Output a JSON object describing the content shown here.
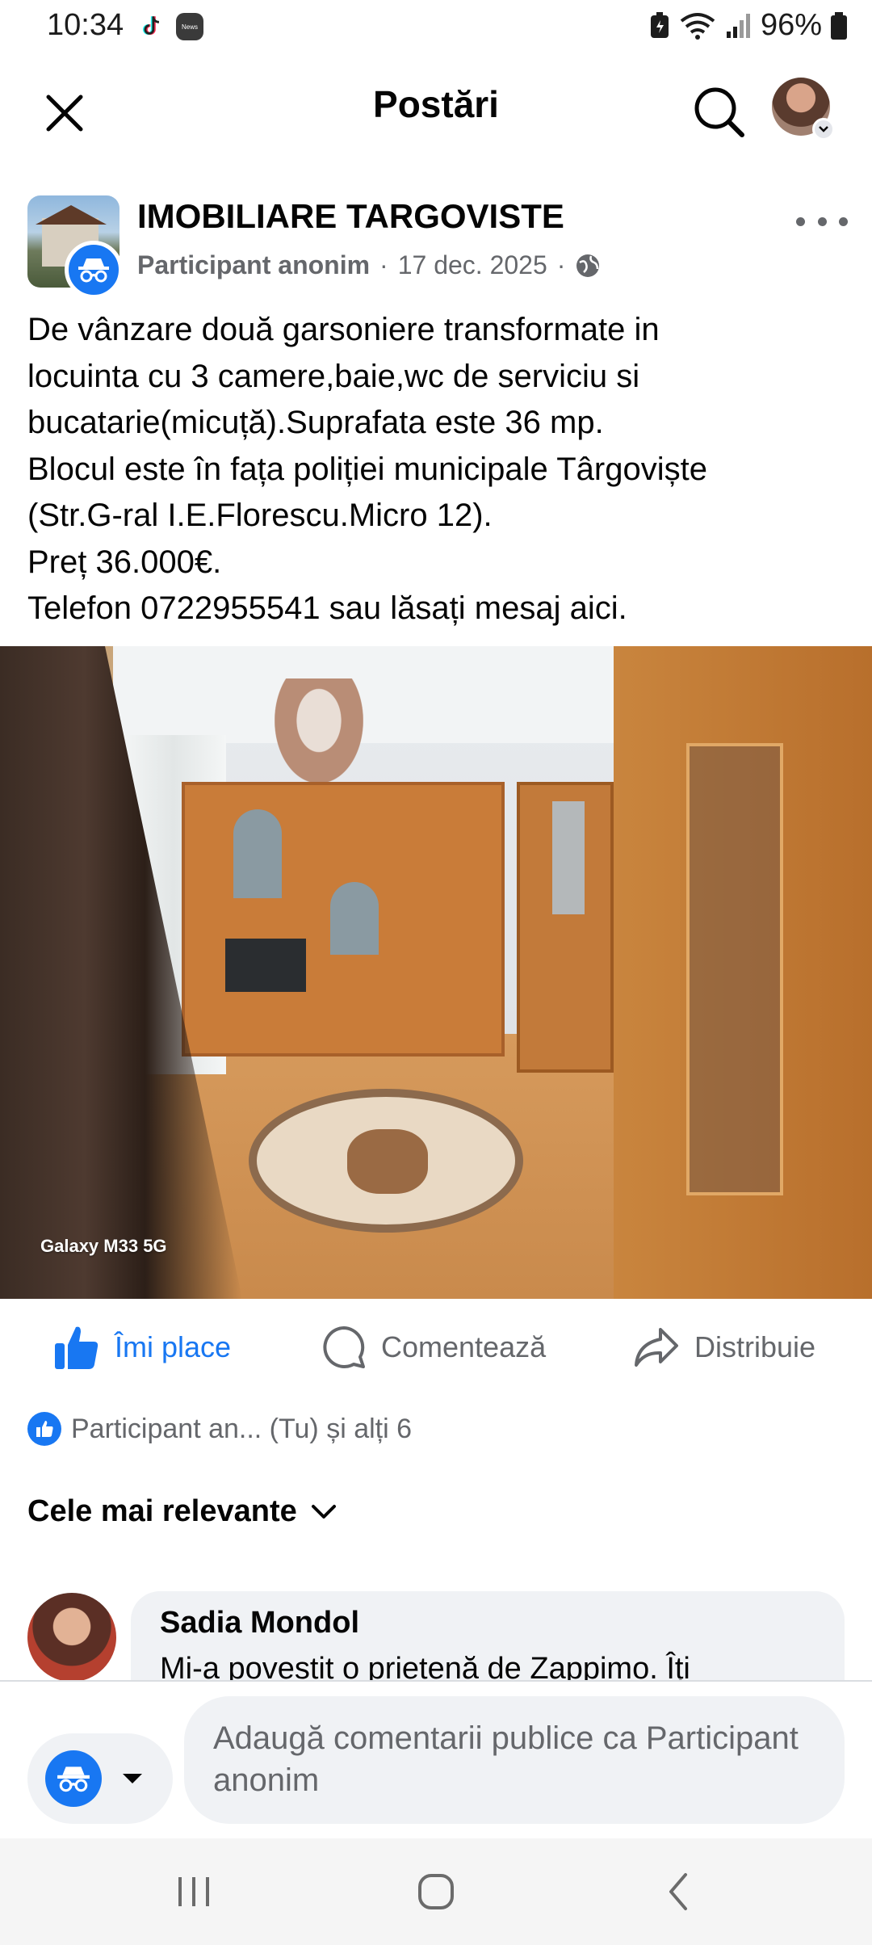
{
  "status_bar": {
    "time": "10:34",
    "news_label": "News",
    "battery": "96%",
    "icons": [
      "tiktok-icon",
      "news-icon",
      "battery-saver-icon",
      "wifi-icon",
      "signal-icon",
      "battery-icon"
    ]
  },
  "header": {
    "title": "Postări",
    "close_icon": "close-icon",
    "search_icon": "search-icon"
  },
  "post": {
    "group_name": "IMOBILIARE TARGOVISTE",
    "author": "Participant anonim",
    "separator": "·",
    "date": "17 dec. 2025",
    "visibility_icon": "globe-icon",
    "text_lines": [
      "De vânzare două garsoniere  transformate in",
      "locuinta cu 3 camere,baie,wc de serviciu si",
      "bucatarie(micuță).Suprafata este 36 mp.",
      "Blocul este în fața poliției municipale Târgoviște",
      "(Str.G-ral I.E.Florescu.Micro 12).",
      "Preț 36.000€.",
      "Telefon 0722955541 sau lăsați mesaj aici."
    ],
    "photo_watermark": "Galaxy M33 5G"
  },
  "actions": {
    "like": "Îmi place",
    "comment": "Comentează",
    "share": "Distribuie"
  },
  "reactions": {
    "summary": "Participant an... (Tu) și alți 6"
  },
  "sort": {
    "label": "Cele mai relevante"
  },
  "comment": {
    "name": "Sadia Mondol",
    "text": "Mi-a povestit o prietenă de Zappimo. Îți"
  },
  "composer": {
    "placeholder": "Adaugă comentarii publice ca Participant anonim"
  },
  "colors": {
    "accent": "#1877f2",
    "secondary_text": "#65676b",
    "bubble": "#f0f2f5"
  }
}
